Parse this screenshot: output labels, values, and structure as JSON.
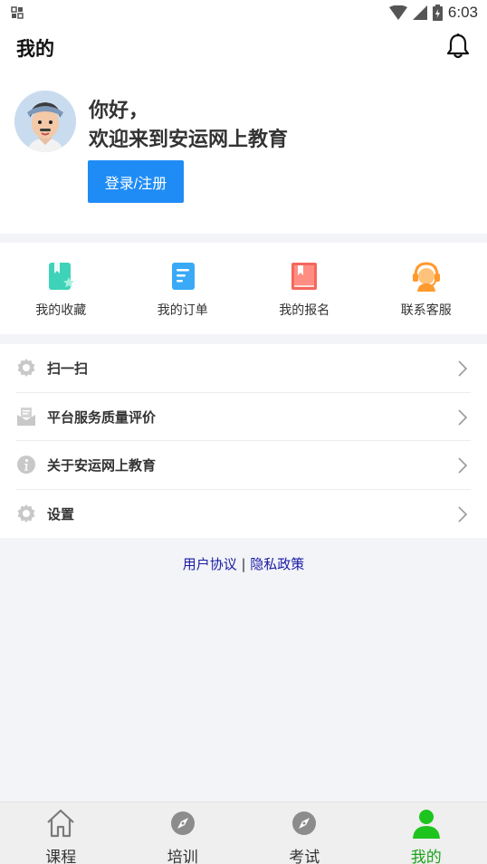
{
  "status_bar": {
    "time": "6:03"
  },
  "header": {
    "title": "我的"
  },
  "profile": {
    "greeting": "你好，",
    "welcome": "欢迎来到安运网上教育",
    "login_label": "登录/注册"
  },
  "quick_actions": [
    {
      "label": "我的收藏",
      "icon": "bookmark-icon",
      "color": "#3ed3b8"
    },
    {
      "label": "我的订单",
      "icon": "order-document-icon",
      "color": "#3aa9f6"
    },
    {
      "label": "我的报名",
      "icon": "registration-book-icon",
      "color": "#f4675c"
    },
    {
      "label": "联系客服",
      "icon": "customer-service-icon",
      "color": "#ff9a2e"
    }
  ],
  "menu": [
    {
      "label": "扫一扫",
      "icon": "gear-icon"
    },
    {
      "label": "平台服务质量评价",
      "icon": "mail-icon"
    },
    {
      "label": "关于安运网上教育",
      "icon": "info-icon"
    },
    {
      "label": "设置",
      "icon": "gear-icon"
    }
  ],
  "footer_links": {
    "agreement": "用户协议",
    "separator": " | ",
    "privacy": "隐私政策"
  },
  "tabs": [
    {
      "label": "课程",
      "icon": "home-icon",
      "active": false
    },
    {
      "label": "培训",
      "icon": "compass-icon",
      "active": false
    },
    {
      "label": "考试",
      "icon": "compass-icon",
      "active": false
    },
    {
      "label": "我的",
      "icon": "person-icon",
      "active": true
    }
  ],
  "colors": {
    "primary": "#1f8cf6",
    "active_tab": "#1aa31a",
    "link": "#1a1aa6"
  }
}
